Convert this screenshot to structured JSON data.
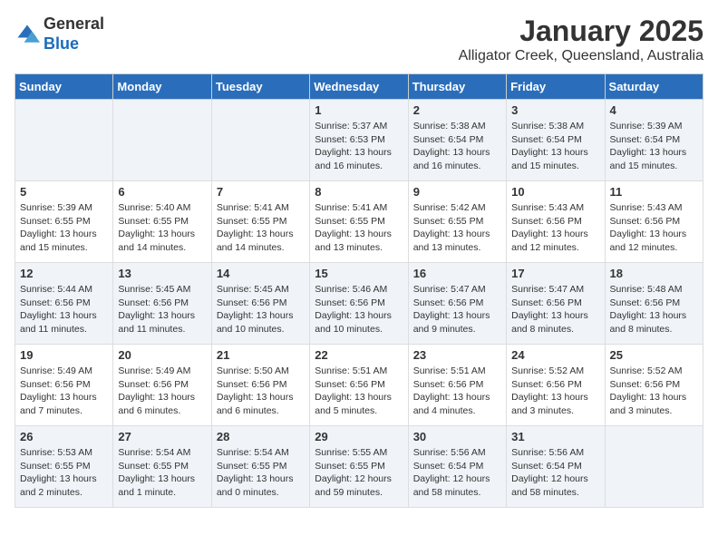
{
  "header": {
    "logo_general": "General",
    "logo_blue": "Blue",
    "month": "January 2025",
    "location": "Alligator Creek, Queensland, Australia"
  },
  "days_of_week": [
    "Sunday",
    "Monday",
    "Tuesday",
    "Wednesday",
    "Thursday",
    "Friday",
    "Saturday"
  ],
  "weeks": [
    [
      {
        "day": "",
        "info": ""
      },
      {
        "day": "",
        "info": ""
      },
      {
        "day": "",
        "info": ""
      },
      {
        "day": "1",
        "info": "Sunrise: 5:37 AM\nSunset: 6:53 PM\nDaylight: 13 hours\nand 16 minutes."
      },
      {
        "day": "2",
        "info": "Sunrise: 5:38 AM\nSunset: 6:54 PM\nDaylight: 13 hours\nand 16 minutes."
      },
      {
        "day": "3",
        "info": "Sunrise: 5:38 AM\nSunset: 6:54 PM\nDaylight: 13 hours\nand 15 minutes."
      },
      {
        "day": "4",
        "info": "Sunrise: 5:39 AM\nSunset: 6:54 PM\nDaylight: 13 hours\nand 15 minutes."
      }
    ],
    [
      {
        "day": "5",
        "info": "Sunrise: 5:39 AM\nSunset: 6:55 PM\nDaylight: 13 hours\nand 15 minutes."
      },
      {
        "day": "6",
        "info": "Sunrise: 5:40 AM\nSunset: 6:55 PM\nDaylight: 13 hours\nand 14 minutes."
      },
      {
        "day": "7",
        "info": "Sunrise: 5:41 AM\nSunset: 6:55 PM\nDaylight: 13 hours\nand 14 minutes."
      },
      {
        "day": "8",
        "info": "Sunrise: 5:41 AM\nSunset: 6:55 PM\nDaylight: 13 hours\nand 13 minutes."
      },
      {
        "day": "9",
        "info": "Sunrise: 5:42 AM\nSunset: 6:55 PM\nDaylight: 13 hours\nand 13 minutes."
      },
      {
        "day": "10",
        "info": "Sunrise: 5:43 AM\nSunset: 6:56 PM\nDaylight: 13 hours\nand 12 minutes."
      },
      {
        "day": "11",
        "info": "Sunrise: 5:43 AM\nSunset: 6:56 PM\nDaylight: 13 hours\nand 12 minutes."
      }
    ],
    [
      {
        "day": "12",
        "info": "Sunrise: 5:44 AM\nSunset: 6:56 PM\nDaylight: 13 hours\nand 11 minutes."
      },
      {
        "day": "13",
        "info": "Sunrise: 5:45 AM\nSunset: 6:56 PM\nDaylight: 13 hours\nand 11 minutes."
      },
      {
        "day": "14",
        "info": "Sunrise: 5:45 AM\nSunset: 6:56 PM\nDaylight: 13 hours\nand 10 minutes."
      },
      {
        "day": "15",
        "info": "Sunrise: 5:46 AM\nSunset: 6:56 PM\nDaylight: 13 hours\nand 10 minutes."
      },
      {
        "day": "16",
        "info": "Sunrise: 5:47 AM\nSunset: 6:56 PM\nDaylight: 13 hours\nand 9 minutes."
      },
      {
        "day": "17",
        "info": "Sunrise: 5:47 AM\nSunset: 6:56 PM\nDaylight: 13 hours\nand 8 minutes."
      },
      {
        "day": "18",
        "info": "Sunrise: 5:48 AM\nSunset: 6:56 PM\nDaylight: 13 hours\nand 8 minutes."
      }
    ],
    [
      {
        "day": "19",
        "info": "Sunrise: 5:49 AM\nSunset: 6:56 PM\nDaylight: 13 hours\nand 7 minutes."
      },
      {
        "day": "20",
        "info": "Sunrise: 5:49 AM\nSunset: 6:56 PM\nDaylight: 13 hours\nand 6 minutes."
      },
      {
        "day": "21",
        "info": "Sunrise: 5:50 AM\nSunset: 6:56 PM\nDaylight: 13 hours\nand 6 minutes."
      },
      {
        "day": "22",
        "info": "Sunrise: 5:51 AM\nSunset: 6:56 PM\nDaylight: 13 hours\nand 5 minutes."
      },
      {
        "day": "23",
        "info": "Sunrise: 5:51 AM\nSunset: 6:56 PM\nDaylight: 13 hours\nand 4 minutes."
      },
      {
        "day": "24",
        "info": "Sunrise: 5:52 AM\nSunset: 6:56 PM\nDaylight: 13 hours\nand 3 minutes."
      },
      {
        "day": "25",
        "info": "Sunrise: 5:52 AM\nSunset: 6:56 PM\nDaylight: 13 hours\nand 3 minutes."
      }
    ],
    [
      {
        "day": "26",
        "info": "Sunrise: 5:53 AM\nSunset: 6:55 PM\nDaylight: 13 hours\nand 2 minutes."
      },
      {
        "day": "27",
        "info": "Sunrise: 5:54 AM\nSunset: 6:55 PM\nDaylight: 13 hours\nand 1 minute."
      },
      {
        "day": "28",
        "info": "Sunrise: 5:54 AM\nSunset: 6:55 PM\nDaylight: 13 hours\nand 0 minutes."
      },
      {
        "day": "29",
        "info": "Sunrise: 5:55 AM\nSunset: 6:55 PM\nDaylight: 12 hours\nand 59 minutes."
      },
      {
        "day": "30",
        "info": "Sunrise: 5:56 AM\nSunset: 6:54 PM\nDaylight: 12 hours\nand 58 minutes."
      },
      {
        "day": "31",
        "info": "Sunrise: 5:56 AM\nSunset: 6:54 PM\nDaylight: 12 hours\nand 58 minutes."
      },
      {
        "day": "",
        "info": ""
      }
    ]
  ]
}
